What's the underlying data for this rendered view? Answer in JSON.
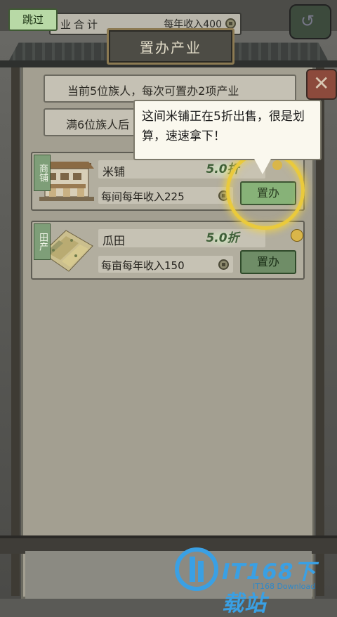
{
  "header": {
    "skip_label": "跳过",
    "total_label": "业合计",
    "total_income": "每年收入400"
  },
  "title": "置办产业",
  "info": {
    "line1": "当前5位族人，每次可置办2项产业",
    "line2": "满6位族人后"
  },
  "tooltip": {
    "text": "这间米铺正在5折出售，很是划算，速速拿下！"
  },
  "properties": [
    {
      "category": "商铺",
      "name": "米铺",
      "discount": "5.0折",
      "income": "每间每年收入225",
      "button": "置办",
      "highlighted": true
    },
    {
      "category": "田产",
      "name": "瓜田",
      "discount": "5.0折",
      "income": "每亩每年收入150",
      "button": "置办",
      "highlighted": false
    }
  ],
  "watermark": {
    "main": "IT168下载站",
    "sub": "IT168 Download"
  },
  "colors": {
    "accent_green": "#7faf75",
    "highlight_gold": "#eaca3c",
    "watermark_blue": "#3aa0e4"
  }
}
